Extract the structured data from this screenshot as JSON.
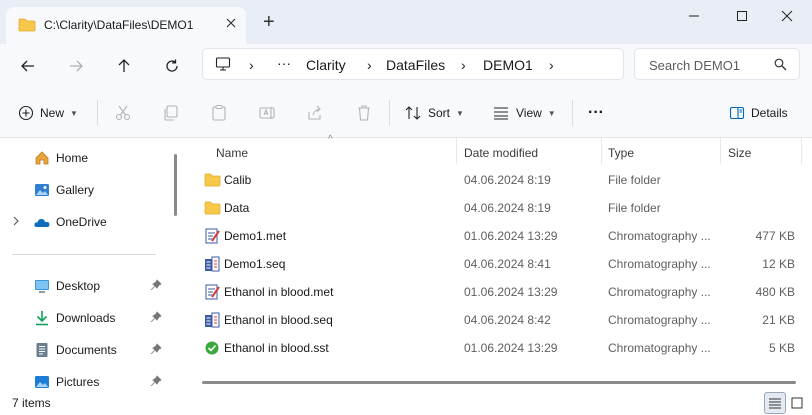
{
  "window": {
    "tab_title": "C:\\Clarity\\DataFiles\\DEMO1",
    "new_tab": "+"
  },
  "address": {
    "overflow": "···",
    "crumbs": [
      "Clarity",
      "DataFiles",
      "DEMO1"
    ],
    "separator": "›"
  },
  "search": {
    "placeholder": "Search DEMO1"
  },
  "toolbar": {
    "new_label": "New",
    "sort_label": "Sort",
    "view_label": "View",
    "more_label": "···",
    "details_label": "Details"
  },
  "sidebar": {
    "items": [
      {
        "label": "Home",
        "icon": "home-icon"
      },
      {
        "label": "Gallery",
        "icon": "gallery-icon"
      },
      {
        "label": "OneDrive",
        "icon": "onedrive-icon"
      },
      {
        "label": "Desktop",
        "icon": "desktop-icon"
      },
      {
        "label": "Downloads",
        "icon": "downloads-icon"
      },
      {
        "label": "Documents",
        "icon": "documents-icon"
      },
      {
        "label": "Pictures",
        "icon": "pictures-icon"
      }
    ]
  },
  "filelist": {
    "columns": [
      "Name",
      "Date modified",
      "Type",
      "Size"
    ],
    "rows": [
      {
        "name": "Calib",
        "date": "04.06.2024 8:19",
        "type": "File folder",
        "size": "",
        "icon": "folder-icon"
      },
      {
        "name": "Data",
        "date": "04.06.2024 8:19",
        "type": "File folder",
        "size": "",
        "icon": "folder-icon"
      },
      {
        "name": "Demo1.met",
        "date": "01.06.2024 13:29",
        "type": "Chromatography ...",
        "size": "477 KB",
        "icon": "method-file-icon"
      },
      {
        "name": "Demo1.seq",
        "date": "04.06.2024 8:41",
        "type": "Chromatography ...",
        "size": "12 KB",
        "icon": "sequence-file-icon"
      },
      {
        "name": "Ethanol in blood.met",
        "date": "01.06.2024 13:29",
        "type": "Chromatography ...",
        "size": "480 KB",
        "icon": "method-file-icon"
      },
      {
        "name": "Ethanol in blood.seq",
        "date": "04.06.2024 8:42",
        "type": "Chromatography ...",
        "size": "21 KB",
        "icon": "sequence-file-icon"
      },
      {
        "name": "Ethanol in blood.sst",
        "date": "01.06.2024 13:29",
        "type": "Chromatography ...",
        "size": "5 KB",
        "icon": "sst-file-icon"
      }
    ]
  },
  "status": {
    "items_text": "7 items"
  },
  "colors": {
    "accent": "#0067c0",
    "folder": "#f8c84a",
    "titlebar": "#e9eef6",
    "toolbar": "#f7f9fc"
  }
}
